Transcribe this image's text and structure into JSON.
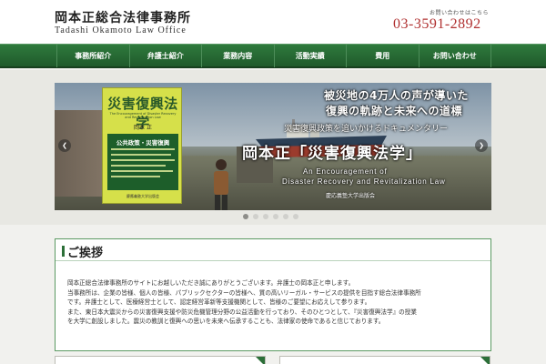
{
  "header": {
    "firm_name": "岡本正総合法律事務所",
    "firm_name_en": "Tadashi Okamoto Law Office",
    "tel_label": "お問い合わせはこちら",
    "tel": "03-3591-2892"
  },
  "nav": {
    "items": [
      {
        "label": "事務所紹介"
      },
      {
        "label": "弁護士紹介"
      },
      {
        "label": "業務内容"
      },
      {
        "label": "活動実績"
      },
      {
        "label": "費用"
      },
      {
        "label": "お問い合わせ"
      }
    ]
  },
  "slider": {
    "book": {
      "title": "災害復興法学",
      "subtitle": "The Encouragement of Disaster Recovery and Revitalization Law",
      "author": "岡本 正",
      "panel_title": "公共政策・災害復興",
      "publisher": "慶應義塾大学出版会"
    },
    "catch_line1": "被災地の4万人の声が導いた",
    "catch_line2": "復興の軌跡と未来への道標",
    "catch_line3": "災害復興政策を追いかけるドキュメンタリー",
    "big_title": "岡本正「災害復興法学」",
    "en_line1": "An Encouragement of",
    "en_line2": "Disaster Recovery and Revitalization Law",
    "publisher": "慶応義塾大学出版会",
    "prev_label": "❮",
    "next_label": "❯",
    "active_slide": 1,
    "slide_count": 6
  },
  "greeting": {
    "title": "ご挨拶",
    "paragraphs": [
      "岡本正総合法律事務所のサイトにお越しいただき誠にありがとうございます。弁護士の岡本正と申します。",
      "当事務所は、企業の皆様、個人の皆様、パブリックセクターの皆様へ、質の高いリーガル・サービスの提供を目指す総合法律事務所",
      "です。弁護士として、医療経営士として、認定経営革新等支援機関として、皆様のご要望にお応えして参ります。",
      "また、東日本大震災からの災害復興支援や防災危機管理分野の公益活動を行っており、そのひとつとして、『災害復興法学』の授業",
      "を大学に創設しました。震災の教訓と復興への思いを未来へ伝承することも、法律家の使命であると信じております。"
    ]
  },
  "colors": {
    "brand_green": "#2c6f38",
    "tel_red": "#b03030"
  }
}
